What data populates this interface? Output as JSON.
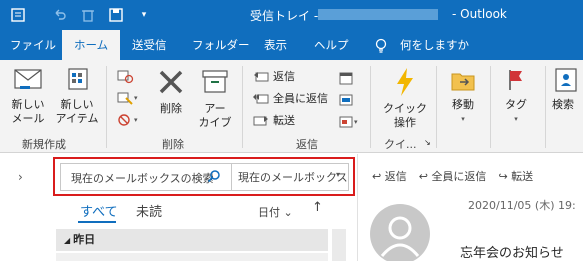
{
  "window": {
    "title": "受信トレイ -",
    "app_name": "- Outlook"
  },
  "tabs": [
    {
      "label": "ファイル"
    },
    {
      "label": "ホーム"
    },
    {
      "label": "送受信"
    },
    {
      "label": "フォルダー"
    },
    {
      "label": "表示"
    },
    {
      "label": "ヘルプ"
    },
    {
      "label": "何をしますか"
    }
  ],
  "ribbon": {
    "new_mail": "新しい\nメール",
    "new_items": "新しい\nアイテム",
    "group_new": "新規作成",
    "delete": "削除",
    "archive": "アー\nカイブ",
    "group_delete": "削除",
    "reply": "返信",
    "reply_all": "全員に返信",
    "forward": "転送",
    "group_respond": "返信",
    "quick_steps": "クイック\n操作",
    "group_quick": "クイ...",
    "move": "移動",
    "tags": "タグ",
    "search": "検索"
  },
  "search": {
    "placeholder": "現在のメールボックスの検索",
    "scope": "現在のメールボックス"
  },
  "filters": {
    "all": "すべて",
    "unread": "未読",
    "sort": "日付"
  },
  "list": {
    "group_header": "昨日"
  },
  "reading": {
    "reply": "返信",
    "reply_all": "全員に返信",
    "forward": "転送",
    "date": "2020/11/05 (木) 19:",
    "subject": "忘年会のお知らせ"
  },
  "colors": {
    "accent": "#106ebe",
    "highlight_box": "#d91c1c"
  }
}
